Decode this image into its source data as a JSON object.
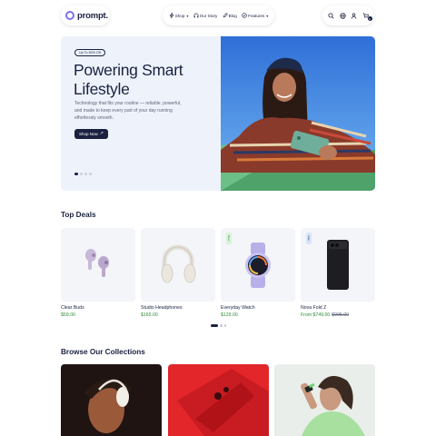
{
  "brand": {
    "name": "prompt."
  },
  "nav": {
    "items": [
      {
        "label": "Shop",
        "icon": "lightning-icon",
        "has_dropdown": true
      },
      {
        "label": "Our Story",
        "icon": "headphones-icon",
        "has_dropdown": false
      },
      {
        "label": "Blog",
        "icon": "pen-icon",
        "has_dropdown": false
      },
      {
        "label": "Features",
        "icon": "features-icon",
        "has_dropdown": true
      }
    ]
  },
  "header_icons": {
    "items": [
      "search-icon",
      "globe-icon",
      "user-icon",
      "cart-icon"
    ],
    "cart_count": "0"
  },
  "hero": {
    "badge": "Up To 50% Off",
    "title": "Powering Smart Lifestyle",
    "subtitle": "Technology that fits your routine — reliable, powerful, and made to keep every part of your day running effortlessly smooth.",
    "cta": "Shop Now",
    "slide_count": 4,
    "active_slide": 1
  },
  "top_deals": {
    "title": "Top Deals",
    "products": [
      {
        "name": "Clear Buds",
        "price": "$59.00",
        "old_price": "",
        "tag": ""
      },
      {
        "name": "Studio Headphones",
        "price": "$165.00",
        "old_price": "",
        "tag": ""
      },
      {
        "name": "Everyday Watch",
        "price": "$129.00",
        "old_price": "",
        "tag": "New"
      },
      {
        "name": "Nova Fold Z",
        "price": "From $749.00",
        "old_price": "$995.00",
        "tag": "Sale"
      }
    ],
    "page_count": 3,
    "active_page": 1
  },
  "collections": {
    "title": "Browse Our Collections"
  },
  "colors": {
    "primary": "#1a2240",
    "accent": "#7f6ff0",
    "price": "#2e8b3a",
    "hero_bg": "#eef3fb",
    "card_bg": "#f3f5f9",
    "tag_new": "#d9f2d9",
    "tag_sale": "#dbe4f7"
  }
}
